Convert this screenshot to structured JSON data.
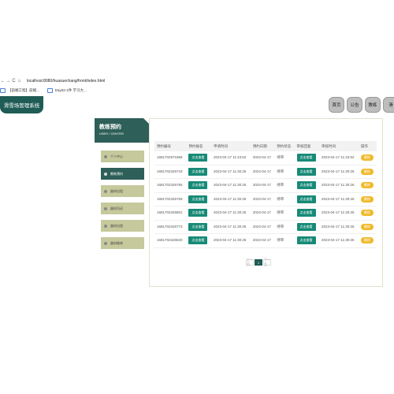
{
  "browser": {
    "back": "←",
    "forward": "→",
    "reload": "C",
    "home": "⌂",
    "url": "localhost:8080/huaxuechang/front/index.html",
    "bookmarks": [
      "【前端工程】前端...",
      "Day02-1件 学习大..."
    ]
  },
  "app": {
    "title": "滑雪场管理系统"
  },
  "topnav": [
    "首页",
    "公告",
    "教练",
    "滑"
  ],
  "center": {
    "title": "教练预约",
    "subtitle": "USER / CENTER"
  },
  "sidebar": {
    "items": [
      "个人中心",
      "教练预约",
      "器材出租",
      "器材归还",
      "器材出租",
      "器材维修"
    ]
  },
  "table": {
    "headers": [
      "预约编号",
      "预约报名",
      "申请时间",
      "预约日期",
      "预约状态",
      "审核回复",
      "审核时间",
      "操作"
    ],
    "rows": [
      {
        "id": "1681702971868",
        "apply": "2023-04-17 11:43:52",
        "date": "2023-04-17",
        "status": "待审",
        "audit_time": "2023-04-17 11:43:52"
      },
      {
        "id": "1681702326743",
        "apply": "2023-04-17 11:30:26",
        "date": "2023-04-17",
        "status": "待审",
        "audit_time": "2023-04-17 11:30:26"
      },
      {
        "id": "1681702326765",
        "apply": "2023-04-17 11:30:26",
        "date": "2023-04-17",
        "status": "待审",
        "audit_time": "2023-04-17 11:30:26"
      },
      {
        "id": "1681702326759",
        "apply": "2023-04-17 11:30:26",
        "date": "2023-04-17",
        "status": "待审",
        "audit_time": "2023-04-17 11:30:26"
      },
      {
        "id": "1681702326801",
        "apply": "2023-04-17 11:30:26",
        "date": "2023-04-17",
        "status": "待审",
        "audit_time": "2023-04-17 11:30:26"
      },
      {
        "id": "1681702326773",
        "apply": "2023-04-17 11:30:26",
        "date": "2023-04-17",
        "status": "待审",
        "audit_time": "2023-04-17 11:30:26"
      },
      {
        "id": "1681702326820",
        "apply": "2023-04-17 11:30:26",
        "date": "2023-04-17",
        "status": "待审",
        "audit_time": "2023-04-17 11:30:26"
      }
    ],
    "view_label": "点击查看",
    "action_label": "删除"
  },
  "pager": {
    "prev": "上一页",
    "current": "1",
    "next": "下一页"
  }
}
